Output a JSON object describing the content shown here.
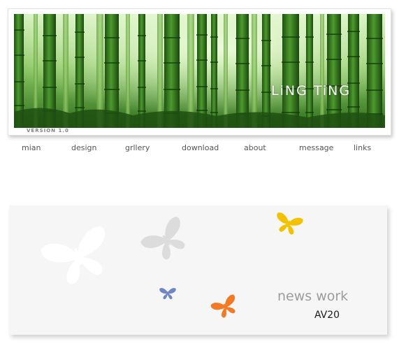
{
  "header": {
    "brand_title": "LiNG TiNG",
    "version_label": "VERSION 1.0",
    "photo": "bamboo-forest"
  },
  "nav": {
    "items": [
      "mian",
      "design",
      "grllery",
      "download",
      "about",
      "message",
      "links"
    ]
  },
  "news": {
    "title": "news work",
    "code": "AV20",
    "decorations": [
      "white-butterfly-icon",
      "grey-butterfly-icon",
      "yellow-butterfly-icon",
      "blue-butterfly-icon",
      "orange-butterfly-icon"
    ]
  },
  "colors": {
    "bamboo_dark": "#2f6f1f",
    "bamboo_light": "#9ed37a",
    "panel_bg": "#f6f6f6",
    "butterfly_yellow": "#f2c200",
    "butterfly_blue": "#6f86c4",
    "butterfly_orange": "#f37a25",
    "butterfly_grey": "#dcdcdc",
    "nav_text": "#555555"
  }
}
